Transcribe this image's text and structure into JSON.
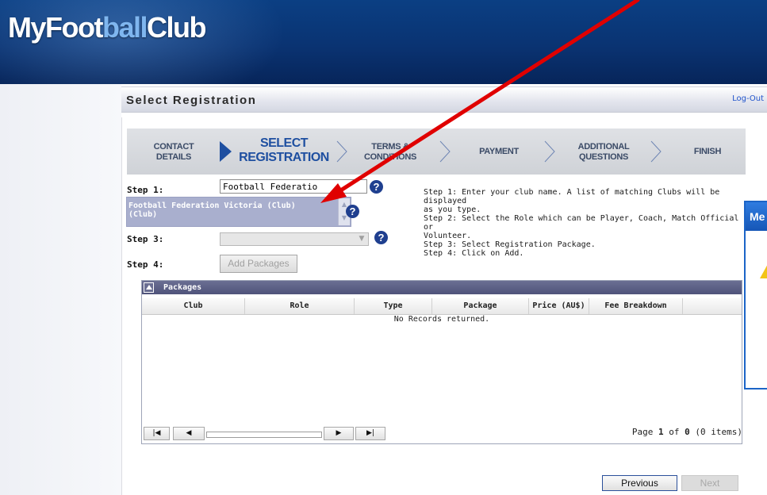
{
  "app": {
    "logo_left": "MyFoot",
    "logo_mid": "ball",
    "logo_right": "Club"
  },
  "titlebar": {
    "page_title": "Select Registration",
    "logout_label": "Log-Out"
  },
  "wizard_steps": [
    {
      "label_line1": "CONTACT",
      "label_line2": "DETAILS",
      "state": "done"
    },
    {
      "label_line1": "SELECT",
      "label_line2": "REGISTRATION",
      "state": "active"
    },
    {
      "label_line1": "TERMS &",
      "label_line2": "CONDITIONS",
      "state": "pending"
    },
    {
      "label_line1": "PAYMENT",
      "label_line2": "",
      "state": "pending"
    },
    {
      "label_line1": "ADDITIONAL",
      "label_line2": "QUESTIONS",
      "state": "pending"
    },
    {
      "label_line1": "FINISH",
      "label_line2": "",
      "state": "pending"
    }
  ],
  "form": {
    "step1_label": "Step 1:",
    "step3_label": "Step 3:",
    "step4_label": "Step 4:",
    "club_input_value": "Football Federatio",
    "suggestion_line1": "Football Federation Victoria (Club)",
    "suggestion_line2": "(Club)",
    "add_packages_label": "Add Packages"
  },
  "instructions": {
    "line1": "Step 1: Enter your club name. A list of matching Clubs will be displayed",
    "line2": "as you type.",
    "line3": "Step 2: Select the Role which can be Player, Coach, Match Official or",
    "line4": "Volunteer.",
    "line5": "Step 3: Select Registration Package.",
    "line6": "Step 4: Click on Add."
  },
  "packages": {
    "title": "Packages",
    "columns": [
      "Club",
      "Role",
      "Type",
      "Package",
      "Price (AU$)",
      "Fee Breakdown"
    ],
    "empty_message": "No Records returned.",
    "pager": {
      "first_symbol": "|◀",
      "prev_symbol": "◀",
      "next_symbol": "▶",
      "last_symbol": "▶|",
      "page_prefix": "Page ",
      "current_page": "1",
      "page_of": " of ",
      "total_pages": "0",
      "items_text": " (0 items)"
    }
  },
  "navigation": {
    "previous_label": "Previous",
    "next_label": "Next"
  },
  "message_window": {
    "title_partial": "Me"
  },
  "colors": {
    "header_blue": "#0a3372",
    "step_active": "#1e4fa0",
    "suggest_bg": "#a9afce",
    "annotation_arrow": "#e00000"
  }
}
